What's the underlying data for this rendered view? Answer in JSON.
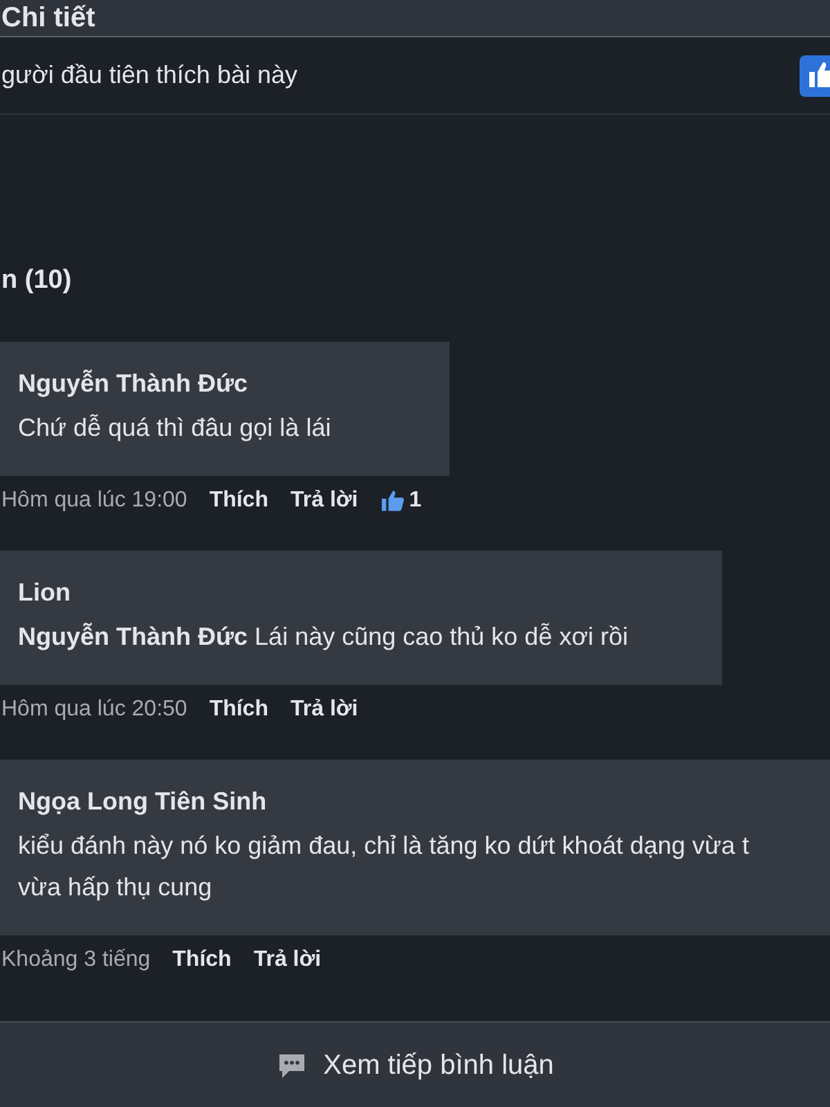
{
  "header": {
    "title": "Chi tiết"
  },
  "like_bar": {
    "text": "gười đầu tiên thích bài này"
  },
  "comments_heading": "n (10)",
  "comments": [
    {
      "author": "Nguyễn Thành Đức",
      "lines": [
        "Chứ dễ quá thì đâu gọi là lái"
      ],
      "time": "Hôm qua lúc 19:00",
      "like": "Thích",
      "reply": "Trả lời",
      "likes": "1"
    },
    {
      "author": "Lion",
      "lines": [
        "**Nguyễn Thành Đức** Lái này cũng cao thủ ko dễ xơi rồi"
      ],
      "time": "Hôm qua lúc 20:50",
      "like": "Thích",
      "reply": "Trả lời"
    },
    {
      "author": "Ngọa Long Tiên Sinh",
      "lines": [
        "kiểu đánh này nó ko giảm đau, chỉ là tăng ko dứt khoát dạng vừa t",
        "vừa hấp thụ cung"
      ],
      "time": "Khoảng 3 tiếng",
      "like": "Thích",
      "reply": "Trả lời"
    }
  ],
  "more_button": "Xem tiếp bình luận"
}
